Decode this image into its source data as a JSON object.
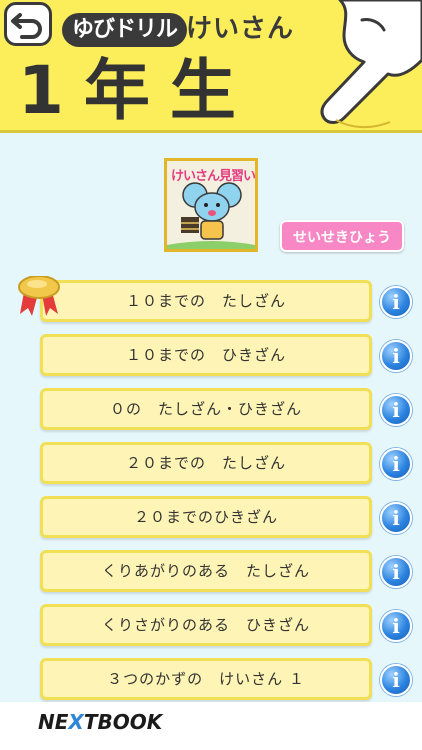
{
  "header": {
    "back_icon": "back-arrow-icon",
    "series": "ゆびドリル",
    "subject": "けいさん",
    "grade": "1年生",
    "background": "#fcee5a"
  },
  "book": {
    "logo_text": "けいさん見習い",
    "records_button": "せいせきひょう"
  },
  "lessons": [
    {
      "label": "１０までの　たしざん",
      "completed": true
    },
    {
      "label": "１０までの　ひきざん",
      "completed": false
    },
    {
      "label": "０の　たしざん・ひきざん",
      "completed": false
    },
    {
      "label": "２０までの　たしざん",
      "completed": false
    },
    {
      "label": "２０までのひきざん",
      "completed": false
    },
    {
      "label": "くりあがりのある　たしざん",
      "completed": false
    },
    {
      "label": "くりさがりのある　ひきざん",
      "completed": false
    },
    {
      "label": "３つのかずの　けいさん １",
      "completed": false
    }
  ],
  "info_icon": "i",
  "footer": {
    "brand_prefix": "NE",
    "brand_x": "X",
    "brand_suffix": "TBOOK"
  }
}
